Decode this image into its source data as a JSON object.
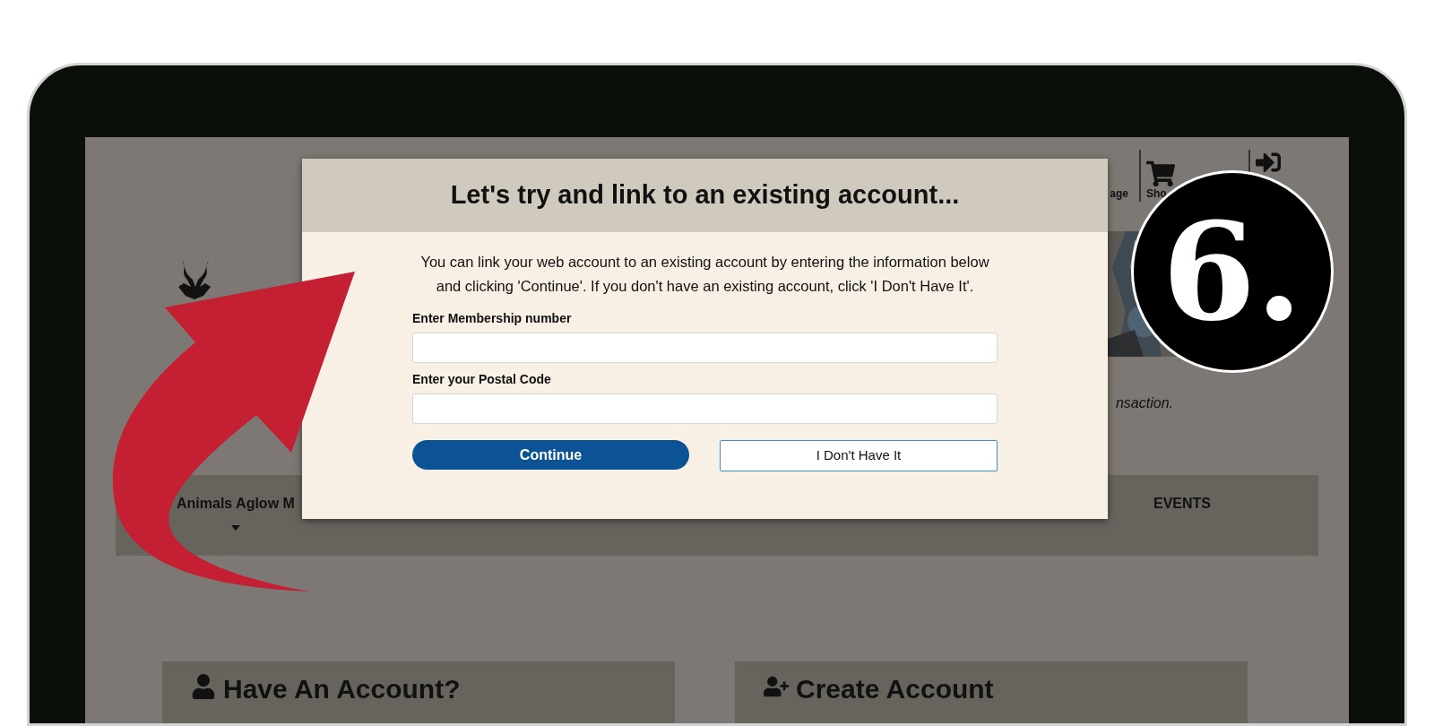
{
  "header": {
    "links": [
      {
        "label": "age"
      },
      {
        "label": "Sho"
      }
    ]
  },
  "notice": "nsaction.",
  "nav": {
    "items": [
      {
        "label": "Animals Aglow M",
        "dropdown": true
      },
      {
        "label": "EVENTS",
        "dropdown": false
      }
    ]
  },
  "cards": [
    {
      "title": "Have An Account?"
    },
    {
      "title": "Create Account"
    }
  ],
  "modal": {
    "title": "Let's try and link to an existing account...",
    "message": "You can link your web account to an existing account by entering the information below and clicking 'Continue'. If you don't have an existing account, click 'I Don't Have It'.",
    "fields": [
      {
        "label": "Enter Membership number"
      },
      {
        "label": "Enter your Postal Code"
      }
    ],
    "buttons": [
      {
        "label": "Continue",
        "kind": "primary"
      },
      {
        "label": "I Don't Have It",
        "kind": "secondary"
      }
    ]
  },
  "step_badge": "6."
}
